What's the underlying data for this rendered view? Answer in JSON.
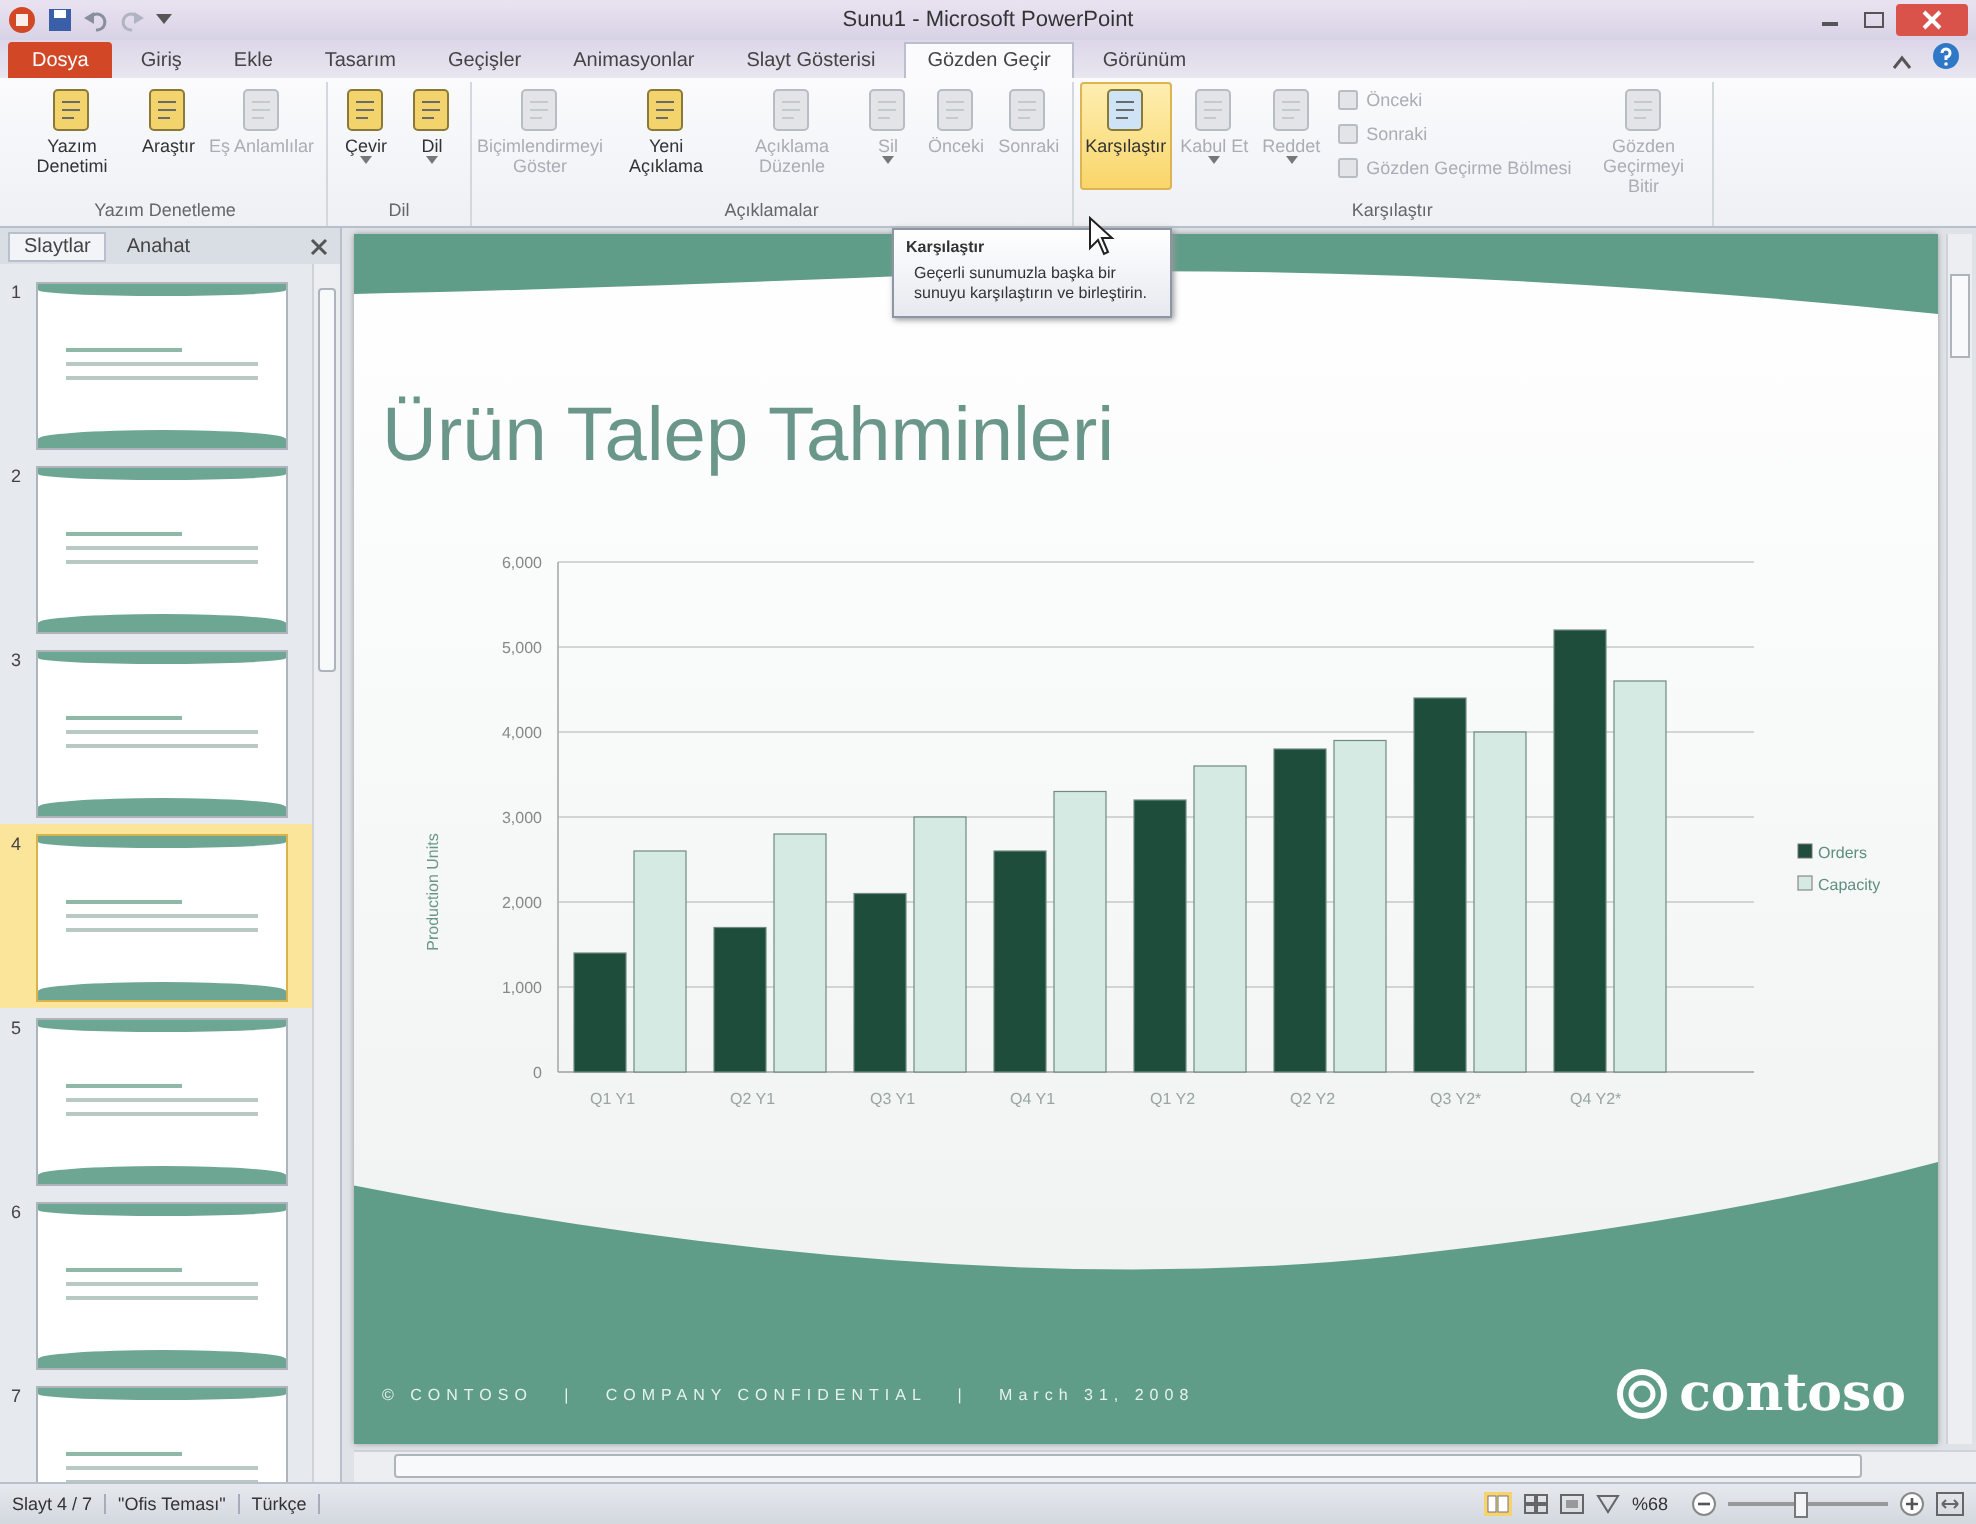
{
  "window": {
    "title": "Sunu1 - Microsoft PowerPoint"
  },
  "ribbon_tabs": [
    {
      "label": "Dosya",
      "kind": "file",
      "selected": false
    },
    {
      "label": "Giriş",
      "kind": "tab",
      "selected": false
    },
    {
      "label": "Ekle",
      "kind": "tab",
      "selected": false
    },
    {
      "label": "Tasarım",
      "kind": "tab",
      "selected": false
    },
    {
      "label": "Geçişler",
      "kind": "tab",
      "selected": false
    },
    {
      "label": "Animasyonlar",
      "kind": "tab",
      "selected": false
    },
    {
      "label": "Slayt Gösterisi",
      "kind": "tab",
      "selected": false
    },
    {
      "label": "Gözden Geçir",
      "kind": "tab",
      "selected": true
    },
    {
      "label": "Görünüm",
      "kind": "tab",
      "selected": false
    }
  ],
  "ribbon_groups": [
    {
      "label": "Yazım Denetleme",
      "items": [
        {
          "kind": "large",
          "label": "Yazım Denetimi",
          "disabled": false,
          "highlighted": false,
          "has_menu": false
        },
        {
          "kind": "large",
          "label": "Araştır",
          "disabled": false,
          "highlighted": false,
          "has_menu": false
        },
        {
          "kind": "large",
          "label": "Eş Anlamlılar",
          "disabled": true,
          "highlighted": false,
          "has_menu": false
        }
      ]
    },
    {
      "label": "Dil",
      "items": [
        {
          "kind": "large",
          "label": "Çevir",
          "disabled": false,
          "highlighted": false,
          "has_menu": true
        },
        {
          "kind": "large",
          "label": "Dil",
          "disabled": false,
          "highlighted": false,
          "has_menu": true
        }
      ]
    },
    {
      "label": "Açıklamalar",
      "items": [
        {
          "kind": "large",
          "label": "Biçimlendirmeyi Göster",
          "disabled": true,
          "highlighted": false,
          "has_menu": false
        },
        {
          "kind": "large",
          "label": "Yeni Açıklama",
          "disabled": false,
          "highlighted": false,
          "has_menu": false
        },
        {
          "kind": "large",
          "label": "Açıklama Düzenle",
          "disabled": true,
          "highlighted": false,
          "has_menu": false
        },
        {
          "kind": "large",
          "label": "Sil",
          "disabled": true,
          "highlighted": false,
          "has_menu": true
        },
        {
          "kind": "large",
          "label": "Önceki",
          "disabled": true,
          "highlighted": false,
          "has_menu": false
        },
        {
          "kind": "large",
          "label": "Sonraki",
          "disabled": true,
          "highlighted": false,
          "has_menu": false
        }
      ]
    },
    {
      "label": "Karşılaştır",
      "items": [
        {
          "kind": "large",
          "label": "Karşılaştır",
          "disabled": false,
          "highlighted": true,
          "has_menu": false
        },
        {
          "kind": "large",
          "label": "Kabul Et",
          "disabled": true,
          "highlighted": false,
          "has_menu": true
        },
        {
          "kind": "large",
          "label": "Reddet",
          "disabled": true,
          "highlighted": false,
          "has_menu": true
        },
        {
          "kind": "stack",
          "buttons": [
            {
              "label": "Önceki",
              "disabled": true
            },
            {
              "label": "Sonraki",
              "disabled": true
            },
            {
              "label": "Gözden Geçirme Bölmesi",
              "disabled": true
            }
          ]
        },
        {
          "kind": "large",
          "label": "Gözden Geçirmeyi Bitir",
          "disabled": true,
          "highlighted": false,
          "has_menu": false
        }
      ]
    }
  ],
  "tooltip": {
    "title": "Karşılaştır",
    "text": "Geçerli sunumuzla başka bir sunuyu karşılaştırın ve birleştirin."
  },
  "slides_panel": {
    "tabs": [
      {
        "label": "Slaytlar",
        "selected": true
      },
      {
        "label": "Anahat",
        "selected": false
      }
    ],
    "slides": [
      {
        "number": "1",
        "selected": false
      },
      {
        "number": "2",
        "selected": false
      },
      {
        "number": "3",
        "selected": false
      },
      {
        "number": "4",
        "selected": true
      },
      {
        "number": "5",
        "selected": false
      },
      {
        "number": "6",
        "selected": false
      },
      {
        "number": "7",
        "selected": false
      }
    ]
  },
  "slide": {
    "title": "Ürün Talep Tahminleri",
    "chart_data": {
      "type": "bar",
      "ylabel": "Production Units",
      "categories": [
        "Q1 Y1",
        "Q2 Y1",
        "Q3 Y1",
        "Q4 Y1",
        "Q1 Y2",
        "Q2 Y2",
        "Q3 Y2*",
        "Q4 Y2*"
      ],
      "series": [
        {
          "name": "Orders",
          "color": "#1e4d3c",
          "values": [
            1400,
            1700,
            2100,
            2600,
            3200,
            3800,
            4400,
            5200
          ]
        },
        {
          "name": "Capacity",
          "color": "#d5eae2",
          "values": [
            2600,
            2800,
            3000,
            3300,
            3600,
            3900,
            4000,
            4600
          ]
        }
      ],
      "ylim": [
        0,
        6000
      ],
      "grid": true,
      "yticks": [
        {
          "value": 0,
          "label": "0"
        },
        {
          "value": 1000,
          "label": "1,000"
        },
        {
          "value": 2000,
          "label": "2,000"
        },
        {
          "value": 3000,
          "label": "3,000"
        },
        {
          "value": 4000,
          "label": "4,000"
        },
        {
          "value": 5000,
          "label": "5,000"
        },
        {
          "value": 6000,
          "label": "6,000"
        }
      ]
    },
    "footer": "© CONTOSO   |   COMPANY CONFIDENTIAL   |   March 31, 2008",
    "logo": "contoso"
  },
  "status_bar": {
    "slide_info": "Slayt 4 / 7",
    "theme": "\"Ofis Teması\"",
    "language": "Türkçe",
    "zoom": "%68",
    "zoom_slider": {
      "level": 0.45
    }
  }
}
